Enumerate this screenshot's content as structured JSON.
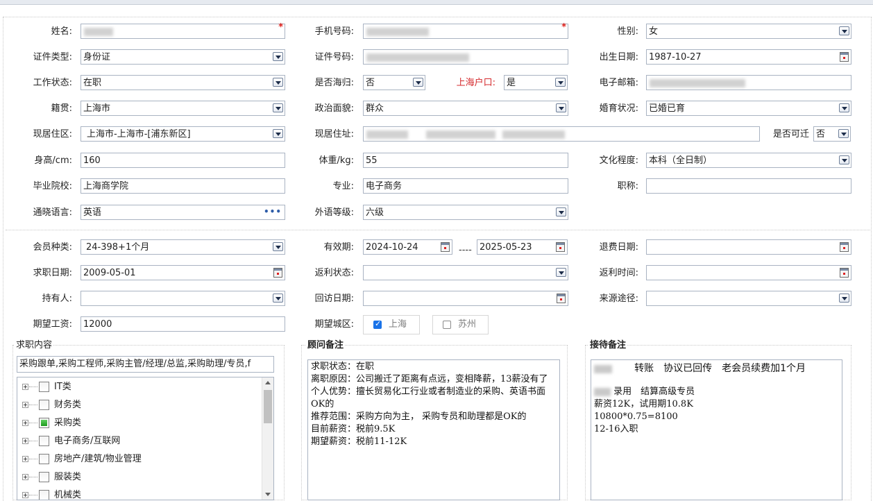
{
  "labels": {
    "name": "姓名:",
    "phone": "手机号码:",
    "gender": "性别:",
    "id_type": "证件类型:",
    "id_no": "证件号码:",
    "birth": "出生日期:",
    "work_status": "工作状态:",
    "returnee": "是否海归:",
    "sh_hukou": "上海户口:",
    "email": "电子邮箱:",
    "native": "籍贯:",
    "political": "政治面貌:",
    "marital": "婚育状况:",
    "area": "现居住区:",
    "address": "现居住址:",
    "relocate": "是否可迁",
    "height": "身高/cm:",
    "weight": "体重/kg:",
    "education": "文化程度:",
    "school": "毕业院校:",
    "major": "专业:",
    "title": "职称:",
    "language": "通晓语言:",
    "lang_level": "外语等级:",
    "member_type": "会员种类:",
    "valid": "有效期:",
    "refund_date": "退费日期:",
    "job_date": "求职日期:",
    "rebate_status": "返利状态:",
    "rebate_time": "返利时间:",
    "holder": "持有人:",
    "visit_date": "回访日期:",
    "source": "来源途径:",
    "salary": "期望工资:",
    "city": "期望城区:"
  },
  "values": {
    "gender": "女",
    "id_type": "身份证",
    "birth": "1987-10-27",
    "work_status": "在职",
    "returnee": "否",
    "sh_hukou": "是",
    "native": "上海市",
    "political": "群众",
    "marital": "已婚已育",
    "area": "上海市-上海市-[浦东新区]",
    "relocate": "否",
    "height": "160",
    "weight": "55",
    "education": "本科（全日制）",
    "school": "上海商学院",
    "major": "电子商务",
    "title": "",
    "language": "英语",
    "lang_level": "六级",
    "member_type": "24-398+1个月",
    "valid_from": "2024-10-24",
    "valid_sep": "----",
    "valid_to": "2025-05-23",
    "refund_date": "",
    "job_date": "2009-05-01",
    "rebate_status": "",
    "rebate_time": "",
    "holder": "",
    "visit_date": "",
    "source": "",
    "salary": "12000"
  },
  "cities": [
    {
      "label": "上海",
      "checked": true
    },
    {
      "label": "苏州",
      "checked": false
    }
  ],
  "panels": {
    "job": {
      "title": "求职内容",
      "summary": "采购跟单,采购工程师,采购主管/经理/总监,采购助理/专员,f",
      "tree": [
        {
          "label": "IT类",
          "state": "none"
        },
        {
          "label": "财务类",
          "state": "none"
        },
        {
          "label": "采购类",
          "state": "partial"
        },
        {
          "label": "电子商务/互联网",
          "state": "none"
        },
        {
          "label": "房地产/建筑/物业管理",
          "state": "none"
        },
        {
          "label": "服装类",
          "state": "none"
        },
        {
          "label": "机械类",
          "state": "none"
        }
      ]
    },
    "consultant": {
      "title": "顾问备注",
      "text": "求职状态：在职\n离职原因：公司搬迁了距离有点远，变相降薪，13薪没有了\n个人优势：擅长贸易化工行业或者制造业的采购、英语书面OK的\n推荐范围：采购方向为主， 采购专员和助理都是OK的\n目前薪资：税前9.5K\n期望薪资：税前11-12K"
    },
    "reception": {
      "title": "接待备注",
      "line1": "转账　协议已回传　老会员续费加1个月",
      "line2": "录用　结算高级专员",
      "line3": "薪资12K，试用期10.8K",
      "line4": "10800*0.75=8100",
      "line5": "12-16入职"
    }
  },
  "required_mark": "*",
  "more_icon": "•••",
  "colors": {
    "required": "#e0201a",
    "hukou_label": "#d4282b",
    "checkbox_on": "#1a73e8"
  }
}
